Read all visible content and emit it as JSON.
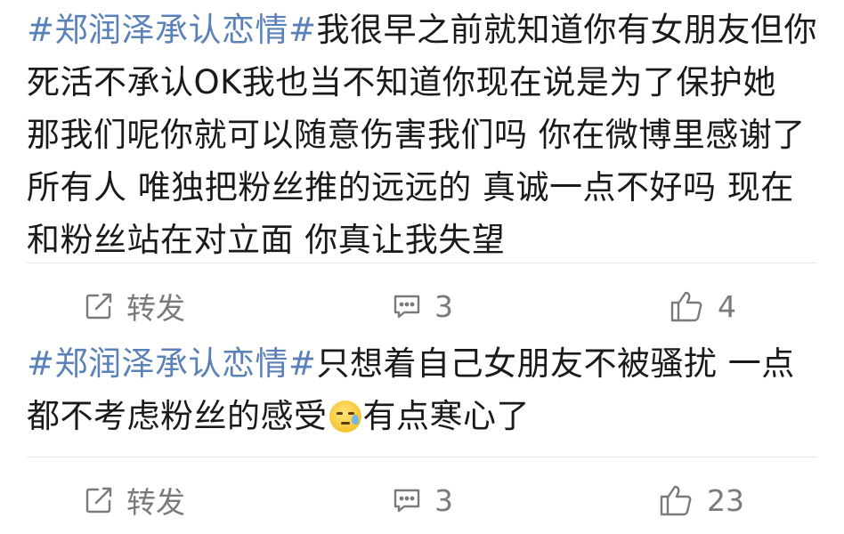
{
  "posts": [
    {
      "hashtag": "#郑润泽承认恋情#",
      "text": "我很早之前就知道你有女朋友但你死活不承认OK我也当不知道你现在说是为了保护她 那我们呢你就可以随意伤害我们吗 你在微博里感谢了所有人 唯独把粉丝推的远远的 真诚一点不好吗 现在和粉丝站在对立面 你真让我失望",
      "repost_label": "转发",
      "comment_count": "3",
      "like_count": "4"
    },
    {
      "hashtag": "#郑润泽承认恋情#",
      "text_before_emoji": "只想着自己女朋友不被骚扰 一点都不考虑粉丝的感受",
      "emoji": "sad-tear-emoji",
      "text_after_emoji": "有点寒心了",
      "repost_label": "转发",
      "comment_count": "3",
      "like_count": "23"
    }
  ],
  "icons": {
    "repost": "edit-square-icon",
    "comment": "comment-bubble-icon",
    "like": "thumbs-up-icon"
  },
  "colors": {
    "hashtag": "#5b82b8",
    "action_gray": "#7a7a7a",
    "divider": "#e6e6e6"
  }
}
